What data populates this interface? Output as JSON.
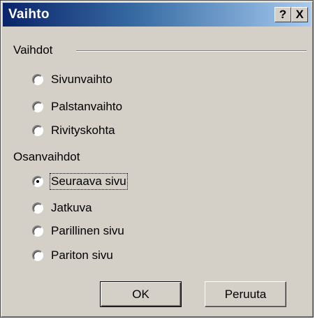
{
  "window": {
    "title": "Vaihto",
    "help_label": "?",
    "close_label": "X"
  },
  "groups": [
    {
      "label": "Vaihdot",
      "options": [
        {
          "label": "Sivunvaihto",
          "checked": false
        },
        {
          "label": "Palstanvaihto",
          "checked": false
        },
        {
          "label": "Rivityskohta",
          "checked": false
        }
      ]
    },
    {
      "label": "Osanvaihdot",
      "options": [
        {
          "label": "Seuraava sivu",
          "checked": true
        },
        {
          "label": "Jatkuva",
          "checked": false
        },
        {
          "label": "Parillinen sivu",
          "checked": false
        },
        {
          "label": "Pariton sivu",
          "checked": false
        }
      ]
    }
  ],
  "buttons": {
    "ok": "OK",
    "cancel": "Peruuta"
  }
}
